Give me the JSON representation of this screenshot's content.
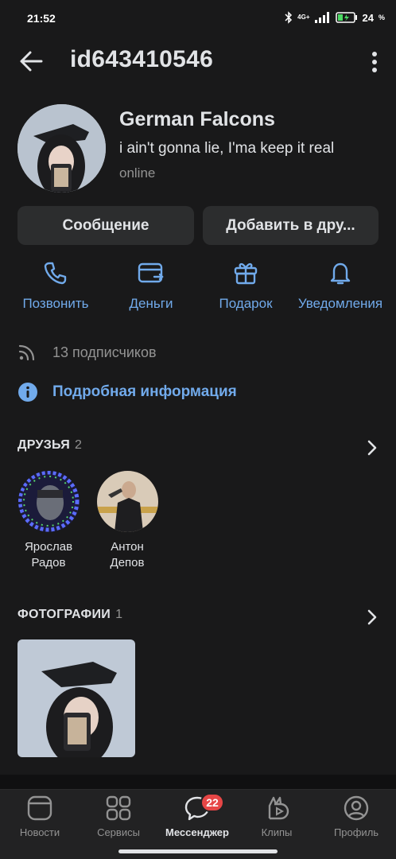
{
  "status_bar": {
    "time": "21:52",
    "network": "4G+",
    "battery": "24"
  },
  "header": {
    "title": "id643410546"
  },
  "profile": {
    "name": "German Falcons",
    "status": "i ain't gonna lie, I'ma keep it real",
    "online": "online"
  },
  "buttons": {
    "message": "Сообщение",
    "add_friend": "Добавить в дру..."
  },
  "actions": [
    {
      "label": "Позвонить",
      "icon": "phone-icon"
    },
    {
      "label": "Деньги",
      "icon": "money-card-icon"
    },
    {
      "label": "Подарок",
      "icon": "gift-icon"
    },
    {
      "label": "Уведомления",
      "icon": "bell-icon"
    }
  ],
  "followers": {
    "text": "13 подписчиков",
    "icon": "rss-icon"
  },
  "details": {
    "text": "Подробная информация",
    "icon": "info-icon"
  },
  "friends": {
    "title": "ДРУЗЬЯ",
    "count": "2",
    "items": [
      {
        "first": "Ярослав",
        "last": "Радов"
      },
      {
        "first": "Антон",
        "last": "Депов"
      }
    ]
  },
  "photos": {
    "title": "ФОТОГРАФИИ",
    "count": "1"
  },
  "tabbar": {
    "items": [
      {
        "label": "Новости",
        "icon": "news-icon"
      },
      {
        "label": "Сервисы",
        "icon": "services-icon"
      },
      {
        "label": "Мессенджер",
        "icon": "messenger-icon",
        "badge": "22"
      },
      {
        "label": "Клипы",
        "icon": "clips-icon"
      },
      {
        "label": "Профиль",
        "icon": "profile-icon"
      }
    ]
  },
  "colors": {
    "background": "#19191a",
    "accent": "#71aaeb",
    "button": "#2c2d2e",
    "badge": "#e64646"
  }
}
